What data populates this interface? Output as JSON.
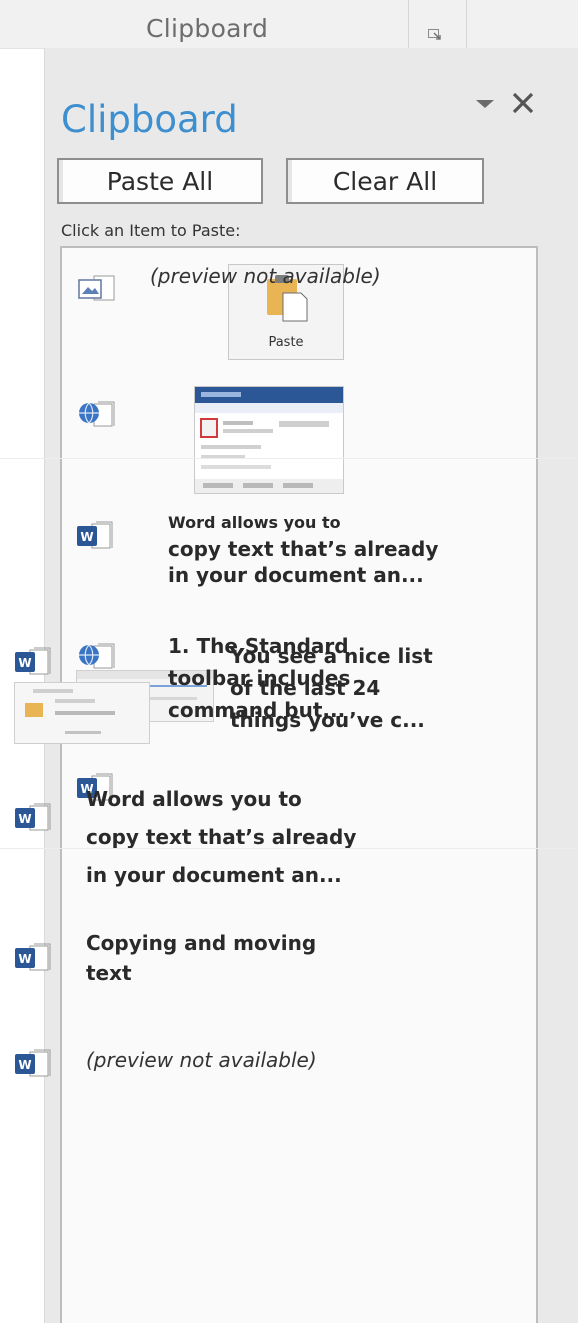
{
  "ribbon": {
    "group_label": "Clipboard"
  },
  "pane": {
    "title": "Clipboard",
    "paste_all": "Paste All",
    "clear_all": "Clear All",
    "hint": "Click an Item to Paste:"
  },
  "items": [
    {
      "kind": "image",
      "source_icon": "image-clip-icon",
      "thumb_label": "Paste"
    },
    {
      "kind": "image",
      "source_icon": "web-clip-icon"
    },
    {
      "kind": "text",
      "source_icon": "word-clip-icon",
      "line1": "Word allows you to",
      "line2": "copy text that’s already\nin your document an..."
    },
    {
      "kind": "mixed",
      "source_icon": "web-clip-icon",
      "text": "You see a nice list\nof the last 24\nthings you’ve c..."
    },
    {
      "kind": "text",
      "source_icon": "word-clip-icon",
      "text": "(preview not available)"
    },
    {
      "kind": "mixed",
      "source_icon": "word-clip-icon",
      "text": "1. The Standard\ntoolbar includes\ncommand but..."
    },
    {
      "kind": "text",
      "source_icon": "word-clip-icon",
      "text": "Word allows you to\ncopy text that’s already\nin your document an..."
    },
    {
      "kind": "text",
      "source_icon": "word-clip-icon",
      "text": "Copying and moving\ntext"
    },
    {
      "kind": "text",
      "source_icon": "word-clip-icon",
      "text": "(preview not available)"
    }
  ],
  "colors": {
    "title_blue": "#3d8fcf",
    "word_blue": "#2b5797",
    "pane_bg": "#e9e9e9"
  }
}
